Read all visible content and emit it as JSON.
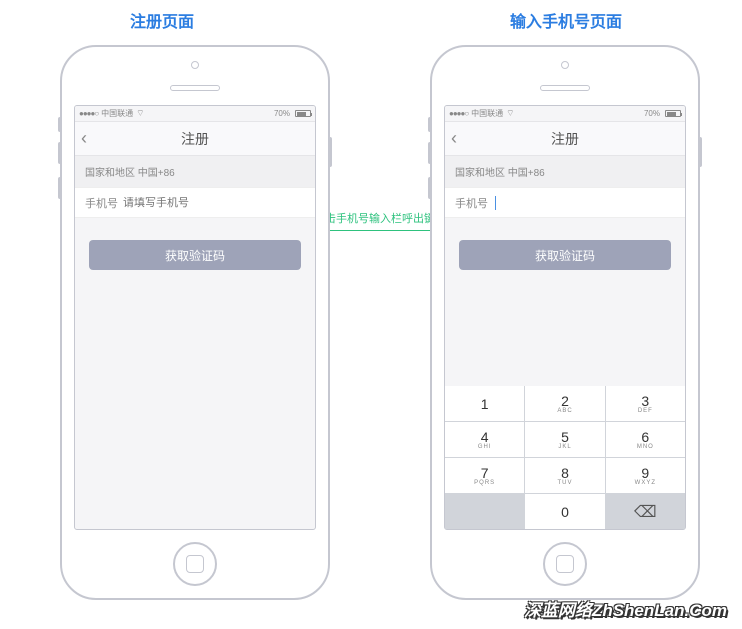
{
  "headers": {
    "left": "注册页面",
    "right": "输入手机号页面"
  },
  "connector_label": "点击手机号输入栏呼出键盘",
  "status": {
    "carrier": "中国联通",
    "signal_dots": "●●●●○",
    "battery_pct": "70%"
  },
  "screen": {
    "nav_title": "注册",
    "region_label": "国家和地区 中国+86",
    "phone_label": "手机号",
    "phone_placeholder": "请填写手机号",
    "verify_button": "获取验证码"
  },
  "keypad": {
    "keys": [
      {
        "n": "1",
        "l": ""
      },
      {
        "n": "2",
        "l": "ABC"
      },
      {
        "n": "3",
        "l": "DEF"
      },
      {
        "n": "4",
        "l": "GHI"
      },
      {
        "n": "5",
        "l": "JKL"
      },
      {
        "n": "6",
        "l": "MNO"
      },
      {
        "n": "7",
        "l": "PQRS"
      },
      {
        "n": "8",
        "l": "TUV"
      },
      {
        "n": "9",
        "l": "WXYZ"
      },
      {
        "n": "",
        "l": ""
      },
      {
        "n": "0",
        "l": ""
      },
      {
        "n": "⌫",
        "l": ""
      }
    ]
  },
  "watermark": "深蓝网络ZhShenLan.Com"
}
